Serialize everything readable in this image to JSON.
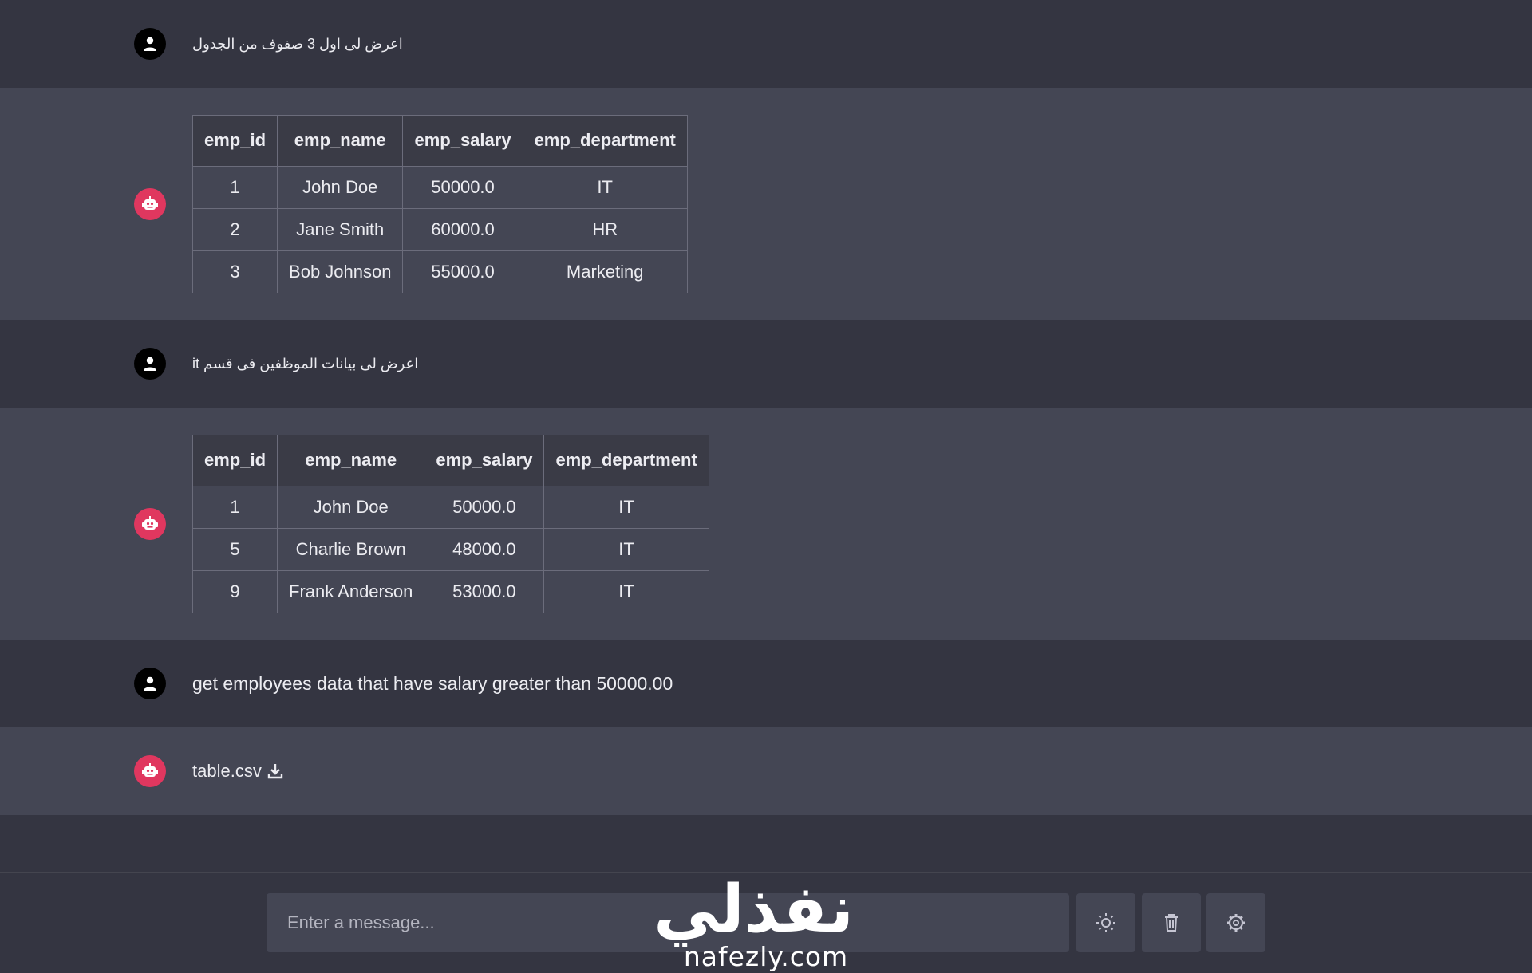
{
  "messages": {
    "q1": "اعرض لى اول 3 صفوف من الجدول",
    "q2": "اعرض لى بيانات الموظفين فى قسم it",
    "q3": "get employees data that have salary greater than 50000.00",
    "file_name": "table.csv"
  },
  "table1": {
    "headers": [
      "emp_id",
      "emp_name",
      "emp_salary",
      "emp_department"
    ],
    "rows": [
      [
        "1",
        "John Doe",
        "50000.0",
        "IT"
      ],
      [
        "2",
        "Jane Smith",
        "60000.0",
        "HR"
      ],
      [
        "3",
        "Bob Johnson",
        "55000.0",
        "Marketing"
      ]
    ]
  },
  "table2": {
    "headers": [
      "emp_id",
      "emp_name",
      "emp_salary",
      "emp_department"
    ],
    "rows": [
      [
        "1",
        "John Doe",
        "50000.0",
        "IT"
      ],
      [
        "5",
        "Charlie Brown",
        "48000.0",
        "IT"
      ],
      [
        "9",
        "Frank Anderson",
        "53000.0",
        "IT"
      ]
    ]
  },
  "input": {
    "placeholder": "Enter a message..."
  },
  "icons": {
    "user": "user-icon",
    "bot": "robot-icon",
    "download": "download-icon",
    "theme": "sun-icon",
    "delete": "trash-icon",
    "settings": "gear-icon"
  },
  "colors": {
    "user_bg": "#343541",
    "bot_bg": "#444654",
    "bot_avatar": "#e0375f",
    "user_avatar": "#000000"
  },
  "watermark": {
    "arabic": "نفذلي",
    "latin": "nafezly.com"
  }
}
